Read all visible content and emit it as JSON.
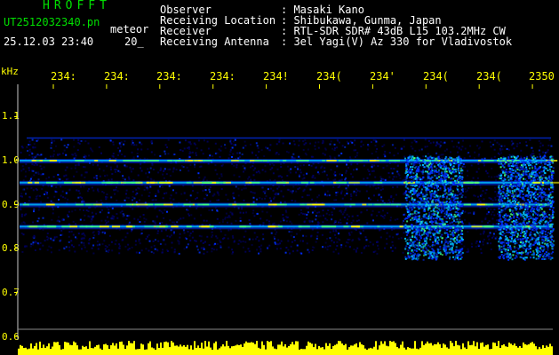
{
  "header": {
    "brand": "HROFFT",
    "filename": "UT2512032340.pn",
    "file_tag": "meteor",
    "datetime": "25.12.03 23:40",
    "datetime_suffix": "20_"
  },
  "info": {
    "labels": [
      "Observer",
      "Receiving Location",
      "Receiver",
      "Receiving Antenna"
    ],
    "values": [
      ": Masaki Kano",
      ": Shibukawa, Gunma, Japan",
      ": RTL-SDR SDR# 43dB L15 103.2MHz CW",
      ": 3el Yagi(V) Az 330 for Vladivostok"
    ]
  },
  "axis": {
    "unit": "kHz",
    "time_ticks": [
      "234:",
      "234:",
      "234:",
      "234:",
      "234!",
      "234(",
      "234'",
      "234(",
      "234(",
      "2350"
    ],
    "freq_ticks": [
      "1.1",
      "1.0",
      "0.9",
      "0.8",
      "0.7",
      "0.6"
    ]
  },
  "colors": {
    "text_white": "#ffffff",
    "text_yellow": "#ffff00",
    "text_green": "#00e000",
    "background": "#000000"
  },
  "chart_data": {
    "type": "heatmap",
    "xlabel": "",
    "ylabel": "kHz",
    "ylim": [
      0.6,
      1.15
    ],
    "x_ticks": [
      "234:",
      "234:",
      "234:",
      "234:",
      "234!",
      "234(",
      "234'",
      "234(",
      "234(",
      "2350"
    ],
    "y_ticks": [
      1.1,
      1.0,
      0.9,
      0.8,
      0.7,
      0.6
    ],
    "signal_bands_khz": [
      1.0,
      0.95,
      0.9,
      0.85
    ],
    "colormap": [
      "#000060",
      "#0030ff",
      "#00c0ff",
      "#40ff80",
      "#ffff00"
    ]
  }
}
